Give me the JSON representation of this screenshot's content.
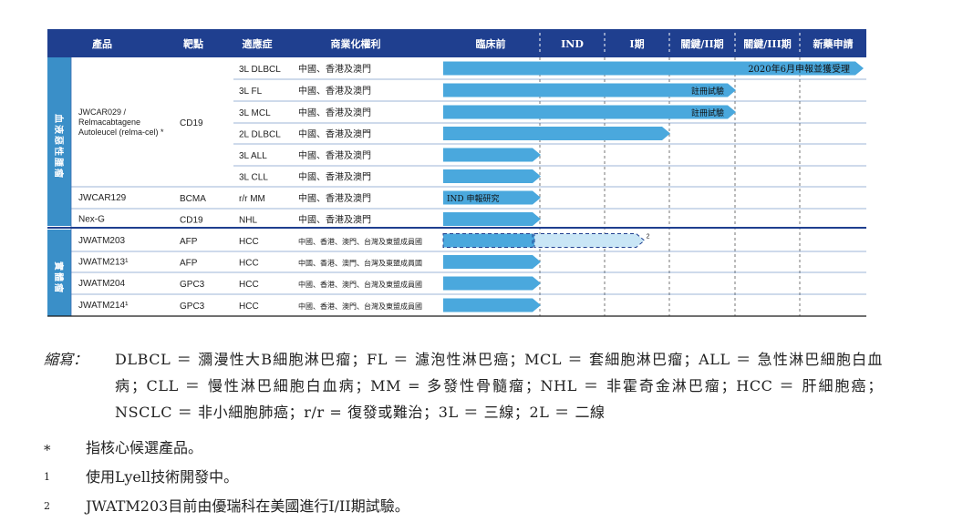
{
  "header": {
    "product": "產品",
    "target": "靶點",
    "indication": "適應症",
    "rights": "商業化權利",
    "stages": [
      "臨床前",
      "IND",
      "I期",
      "關鍵/II期",
      "關鍵/III期",
      "新藥申請"
    ]
  },
  "groups": [
    {
      "label": "血液惡性腫瘤"
    },
    {
      "label": "實體瘤"
    }
  ],
  "products": [
    {
      "name": "JWCAR029 /\nRelmacabtagene\nAutoleucel (relma-cel) *",
      "target": "CD19"
    },
    {
      "name": "JWCAR129",
      "target": "BCMA"
    },
    {
      "name": "Nex-G",
      "target": "CD19"
    },
    {
      "name": "JWATM203",
      "target": "AFP"
    },
    {
      "name": "JWATM213¹",
      "target": "AFP"
    },
    {
      "name": "JWATM204",
      "target": "GPC3"
    },
    {
      "name": "JWATM214¹",
      "target": "GPC3"
    }
  ],
  "rows": [
    {
      "indication": "3L DLBCL",
      "rights": "中國、香港及澳門",
      "progress": 6.0,
      "label": "2020年6月申報並獲受理"
    },
    {
      "indication": "3L FL",
      "rights": "中國、香港及澳門",
      "progress": 4.0,
      "label": "註冊試驗"
    },
    {
      "indication": "3L MCL",
      "rights": "中國、香港及澳門",
      "progress": 4.0,
      "label": "註冊試驗"
    },
    {
      "indication": "2L DLBCL",
      "rights": "中國、香港及澳門",
      "progress": 3.0,
      "label": ""
    },
    {
      "indication": "3L ALL",
      "rights": "中國、香港及澳門",
      "progress": 1.0,
      "label": ""
    },
    {
      "indication": "3L CLL",
      "rights": "中國、香港及澳門",
      "progress": 1.0,
      "label": ""
    },
    {
      "indication": "r/r MM",
      "rights": "中國、香港及澳門",
      "progress": 1.0,
      "label": "IND 申報研究"
    },
    {
      "indication": "NHL",
      "rights": "中國、香港及澳門",
      "progress": 1.0,
      "label": ""
    },
    {
      "indication": "HCC",
      "rights": "中國、香港、澳門、台灣及東盟成員國",
      "progress": 1.0,
      "dashed_progress": 2.6,
      "note": "2"
    },
    {
      "indication": "HCC",
      "rights": "中國、香港、澳門、台灣及東盟成員國",
      "progress": 1.0,
      "label": ""
    },
    {
      "indication": "HCC",
      "rights": "中國、香港、澳門、台灣及東盟成員國",
      "progress": 1.0,
      "label": ""
    },
    {
      "indication": "HCC",
      "rights": "中國、香港、澳門、台灣及東盟成員國",
      "progress": 1.0,
      "label": ""
    }
  ],
  "colors": {
    "header_bg": "#1f3f8f",
    "group_bg": "#3a8fc8",
    "bar": "#4aa8dd",
    "bar_dashed_fill": "#c9e6f6",
    "row_line": "#3a6db0",
    "divider": "#1f3f8f"
  },
  "notes": {
    "abbr_label": "縮寫：",
    "abbr_text": "DLBCL ＝ 瀰漫性大B細胞淋巴瘤；FL ＝ 濾泡性淋巴癌；MCL ＝ 套細胞淋巴瘤；ALL ＝ 急性淋巴細胞白血病；CLL ＝ 慢性淋巴細胞白血病；MM = 多發性骨髓瘤；NHL ＝ 非霍奇金淋巴瘤；HCC ＝ 肝細胞癌；NSCLC ＝ 非小細胞肺癌；r/r = 復發或難治；3L ＝ 三線；2L ＝ 二線",
    "footnotes": [
      {
        "mark": "*",
        "text": "指核心候選產品。"
      },
      {
        "mark": "1",
        "text": "使用Lyell技術開發中。"
      },
      {
        "mark": "2",
        "text": "JWATM203目前由優瑞科在美國進行I/II期試驗。"
      }
    ]
  }
}
